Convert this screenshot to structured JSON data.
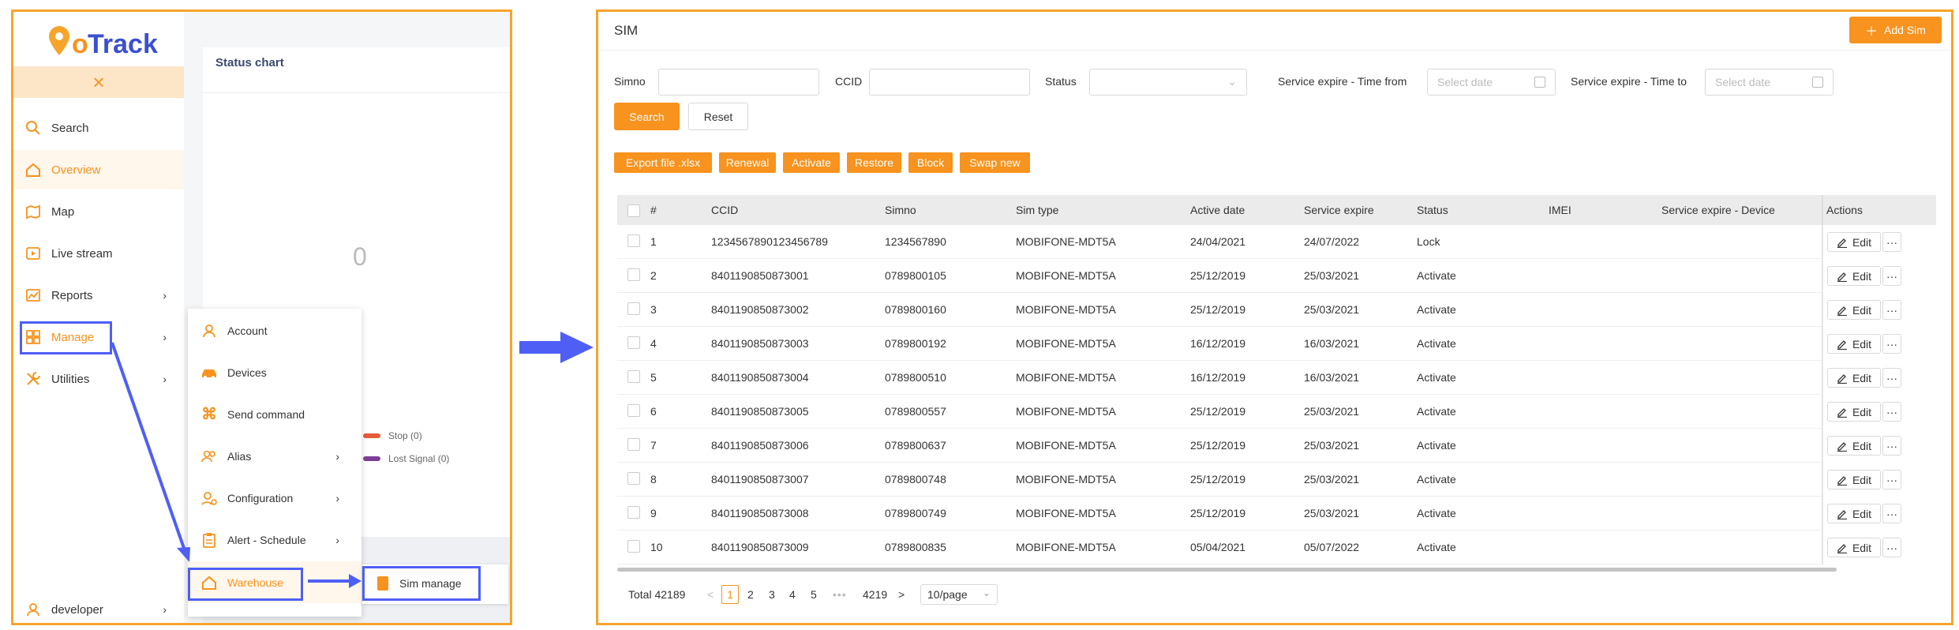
{
  "brand": {
    "logo_text": "GoTrack",
    "accent": "#f7931e",
    "highlight": "#4f5ff5"
  },
  "sidebar": {
    "collapse_icon": "×",
    "items": [
      {
        "label": "Search",
        "icon": "search-icon"
      },
      {
        "label": "Overview",
        "icon": "home-icon"
      },
      {
        "label": "Map",
        "icon": "map-icon"
      },
      {
        "label": "Live stream",
        "icon": "play-icon"
      },
      {
        "label": "Reports",
        "icon": "chart-icon"
      },
      {
        "label": "Manage",
        "icon": "grid-icon"
      },
      {
        "label": "Utilities",
        "icon": "tools-icon"
      }
    ],
    "user": "developer"
  },
  "status_chart": {
    "title": "Status chart",
    "total": "0",
    "legend": [
      "Stop (0)",
      "Lost Signal (0)"
    ]
  },
  "manage_menu": {
    "items": [
      {
        "label": "Account"
      },
      {
        "label": "Devices"
      },
      {
        "label": "Send command"
      },
      {
        "label": "Alias"
      },
      {
        "label": "Configuration"
      },
      {
        "label": "Alert - Schedule"
      },
      {
        "label": "Warehouse"
      }
    ],
    "sim_manage": "Sim manage"
  },
  "sim_page": {
    "title": "SIM",
    "add_button": "Add Sim",
    "filters": {
      "simno": "Simno",
      "ccid": "CCID",
      "status": "Status",
      "time_from": "Service expire - Time from",
      "time_to": "Service expire - Time to",
      "date_placeholder": "Select date"
    },
    "search_button": "Search",
    "reset_button": "Reset",
    "actions": [
      "Export file .xlsx",
      "Renewal",
      "Activate",
      "Restore",
      "Block",
      "Swap new"
    ],
    "columns": [
      "#",
      "CCID",
      "Simno",
      "Sim type",
      "Active date",
      "Service expire",
      "Status",
      "IMEI",
      "Service expire - Device",
      "Actions"
    ],
    "edit_label": "Edit",
    "more_label": "···",
    "rows": [
      [
        "1",
        "1234567890123456789",
        "1234567890",
        "MOBIFONE-MDT5A",
        "24/04/2021",
        "24/07/2022",
        "Lock"
      ],
      [
        "2",
        "8401190850873001",
        "0789800105",
        "MOBIFONE-MDT5A",
        "25/12/2019",
        "25/03/2021",
        "Activate"
      ],
      [
        "3",
        "8401190850873002",
        "0789800160",
        "MOBIFONE-MDT5A",
        "25/12/2019",
        "25/03/2021",
        "Activate"
      ],
      [
        "4",
        "8401190850873003",
        "0789800192",
        "MOBIFONE-MDT5A",
        "16/12/2019",
        "16/03/2021",
        "Activate"
      ],
      [
        "5",
        "8401190850873004",
        "0789800510",
        "MOBIFONE-MDT5A",
        "16/12/2019",
        "16/03/2021",
        "Activate"
      ],
      [
        "6",
        "8401190850873005",
        "0789800557",
        "MOBIFONE-MDT5A",
        "25/12/2019",
        "25/03/2021",
        "Activate"
      ],
      [
        "7",
        "8401190850873006",
        "0789800637",
        "MOBIFONE-MDT5A",
        "25/12/2019",
        "25/03/2021",
        "Activate"
      ],
      [
        "8",
        "8401190850873007",
        "0789800748",
        "MOBIFONE-MDT5A",
        "25/12/2019",
        "25/03/2021",
        "Activate"
      ],
      [
        "9",
        "8401190850873008",
        "0789800749",
        "MOBIFONE-MDT5A",
        "25/12/2019",
        "25/03/2021",
        "Activate"
      ],
      [
        "10",
        "8401190850873009",
        "0789800835",
        "MOBIFONE-MDT5A",
        "05/04/2021",
        "05/07/2022",
        "Activate"
      ]
    ],
    "pagination": {
      "total": "Total 42189",
      "pages": [
        "1",
        "2",
        "3",
        "4",
        "5"
      ],
      "ellipsis": "•••",
      "last": "4219",
      "page_size": "10/page",
      "prev": "<",
      "next": ">"
    }
  }
}
